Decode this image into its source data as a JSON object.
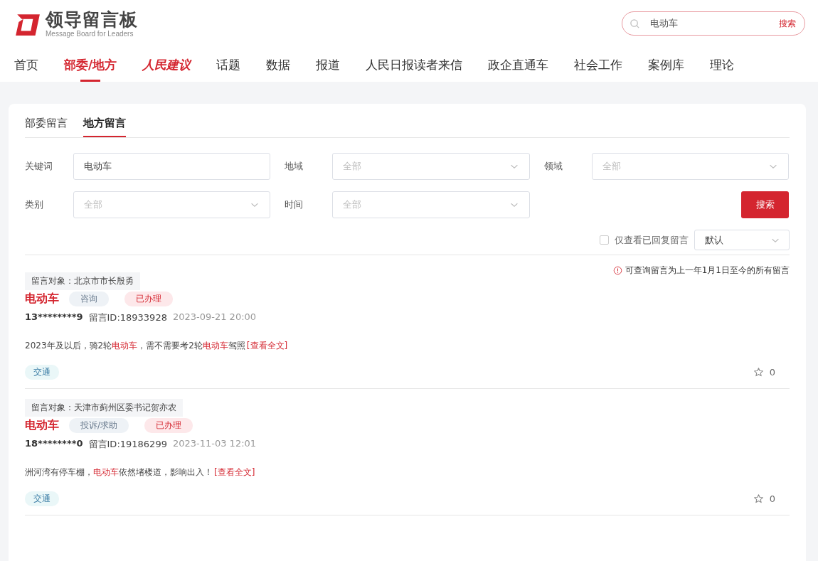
{
  "header": {
    "logo_title": "领导留言板",
    "logo_subtitle": "Message Board for Leaders",
    "search": {
      "value": "电动车",
      "button": "搜索"
    }
  },
  "nav": [
    {
      "label": "首页",
      "kind": "text",
      "selected": false
    },
    {
      "label": "部委/地方",
      "kind": "text",
      "selected": true
    },
    {
      "label": "人民建议",
      "kind": "brand",
      "selected": false
    },
    {
      "label": "话题",
      "kind": "text",
      "selected": false
    },
    {
      "label": "数据",
      "kind": "text",
      "selected": false
    },
    {
      "label": "报道",
      "kind": "text",
      "selected": false
    },
    {
      "label": "人民日报读者来信",
      "kind": "text",
      "selected": false
    },
    {
      "label": "政企直通车",
      "kind": "text",
      "selected": false
    },
    {
      "label": "社会工作",
      "kind": "text",
      "selected": false
    },
    {
      "label": "案例库",
      "kind": "text",
      "selected": false
    },
    {
      "label": "理论",
      "kind": "text",
      "selected": false
    }
  ],
  "tabs": [
    {
      "label": "部委留言",
      "selected": false
    },
    {
      "label": "地方留言",
      "selected": true
    }
  ],
  "filters": [
    {
      "label": "关键词",
      "kind": "input",
      "value": "电动车"
    },
    {
      "label": "地域",
      "kind": "select",
      "placeholder": "全部"
    },
    {
      "label": "领域",
      "kind": "select",
      "placeholder": "全部"
    },
    {
      "label": "类别",
      "kind": "select",
      "placeholder": "全部"
    },
    {
      "label": "时间",
      "kind": "select",
      "placeholder": "全部"
    }
  ],
  "search_button": "搜索",
  "replied_only": {
    "label": "仅查看已回复留言",
    "checked": false
  },
  "sort": {
    "value": "默认"
  },
  "notice": "可查询留言为上一年1月1日至今的所有留言",
  "posts": [
    {
      "recipient": "留言对象：北京市市长殷勇",
      "title": "电动车",
      "category": "咨询",
      "status": "已办理",
      "user": "13********9",
      "message_id": "留言ID:18933928",
      "time": "2023-09-21 20:00",
      "excerpt": [
        {
          "text": "2023年及以后，骑2轮",
          "highlight": false
        },
        {
          "text": "电动车",
          "highlight": true
        },
        {
          "text": "，需不需要考2轮",
          "highlight": false
        },
        {
          "text": "电动车",
          "highlight": true
        },
        {
          "text": "驾照",
          "highlight": false
        }
      ],
      "read_more": "[查看全文]",
      "field": "交通",
      "likes": "0"
    },
    {
      "recipient": "留言对象：天津市蓟州区委书记贺亦农",
      "title": "电动车",
      "category": "投诉/求助",
      "status": "已办理",
      "user": "18********0",
      "message_id": "留言ID:19186299",
      "time": "2023-11-03 12:01",
      "excerpt": [
        {
          "text": "洲河湾有停车棚，",
          "highlight": false
        },
        {
          "text": "电动车",
          "highlight": true
        },
        {
          "text": "依然堵楼道，影响出入！",
          "highlight": false
        }
      ],
      "read_more": "[查看全文]",
      "field": "交通",
      "likes": "0"
    }
  ]
}
